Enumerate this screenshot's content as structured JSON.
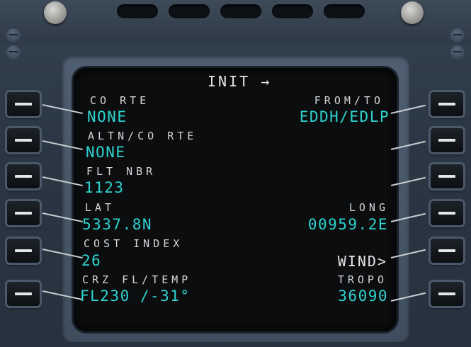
{
  "page": {
    "title": "INIT →"
  },
  "left_fields": [
    {
      "label": "CO RTE",
      "value": "NONE"
    },
    {
      "label": "ALTN/CO RTE",
      "value": "NONE"
    },
    {
      "label": "FLT NBR",
      "value": "1123"
    },
    {
      "label": "LAT",
      "value": "5337.8N"
    },
    {
      "label": "COST INDEX",
      "value": "26"
    },
    {
      "label": "CRZ FL/TEMP",
      "value": "FL230 /-31°"
    }
  ],
  "right_fields": [
    {
      "label": "FROM/TO",
      "value": "EDDH/EDLP"
    },
    {
      "label": "",
      "value": ""
    },
    {
      "label": "",
      "value": ""
    },
    {
      "label": "LONG",
      "value": "00959.2E"
    },
    {
      "label": "",
      "value": "WIND>"
    },
    {
      "label": "TROPO",
      "value": "36090"
    }
  ],
  "colors": {
    "label": "#d4d6d8",
    "data": "#2fd4d0",
    "screen": "#0b0d0f",
    "bezel": "#2b3744"
  }
}
